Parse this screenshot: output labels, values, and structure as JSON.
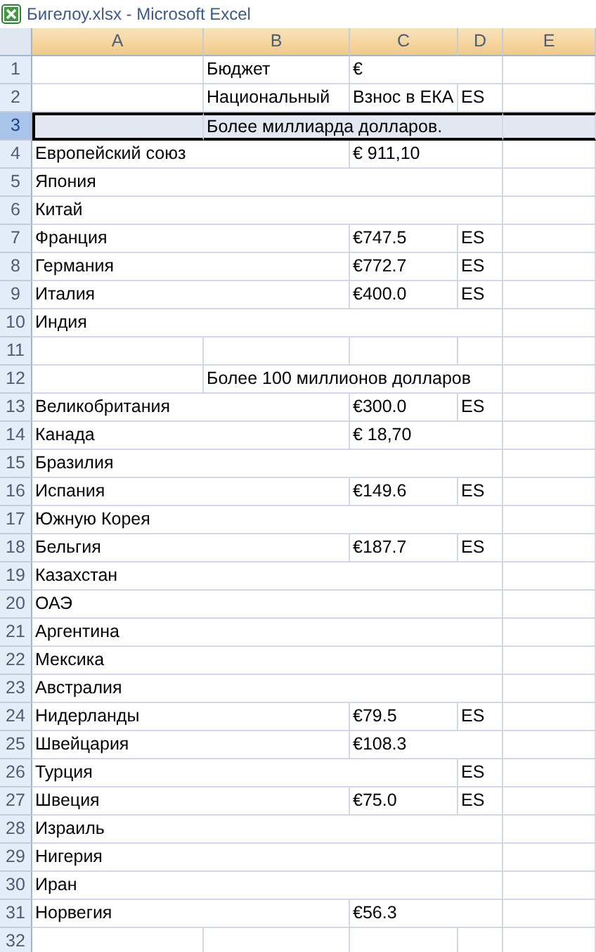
{
  "window": {
    "title": "Бигелоу.xlsx - Microsoft Excel"
  },
  "columns": [
    "A",
    "B",
    "C",
    "D",
    "E"
  ],
  "rows": [
    {
      "number": "1",
      "selected": false,
      "cells": {
        "b": "Бюджет",
        "c": "€"
      }
    },
    {
      "number": "2",
      "selected": false,
      "cells": {
        "b": "Национальный",
        "c": "Взнос в ЕКА",
        "d": "ES"
      }
    },
    {
      "number": "3",
      "selected": true,
      "cells": {
        "b": "Более миллиарда долларов."
      }
    },
    {
      "number": "4",
      "selected": false,
      "cells": {
        "a": "Европейский союз",
        "c": "€ 911,10"
      }
    },
    {
      "number": "5",
      "selected": false,
      "cells": {
        "a": "Япония"
      }
    },
    {
      "number": "6",
      "selected": false,
      "cells": {
        "a": "Китай"
      }
    },
    {
      "number": "7",
      "selected": false,
      "cells": {
        "a": "Франция",
        "c": "€747.5",
        "d": "ES"
      }
    },
    {
      "number": "8",
      "selected": false,
      "cells": {
        "a": "Германия",
        "c": "€772.7",
        "d": "ES"
      }
    },
    {
      "number": "9",
      "selected": false,
      "cells": {
        "a": "Италия",
        "c": "€400.0",
        "d": "ES"
      }
    },
    {
      "number": "10",
      "selected": false,
      "cells": {
        "a": "Индия"
      }
    },
    {
      "number": "11",
      "selected": false,
      "cells": {}
    },
    {
      "number": "12",
      "selected": false,
      "cells": {
        "b": "Более 100 миллионов долларов"
      }
    },
    {
      "number": "13",
      "selected": false,
      "cells": {
        "a": "Великобритания",
        "c": "€300.0",
        "d": "ES"
      }
    },
    {
      "number": "14",
      "selected": false,
      "cells": {
        "a": "Канада",
        "c": "€ 18,70"
      }
    },
    {
      "number": "15",
      "selected": false,
      "cells": {
        "a": "Бразилия"
      }
    },
    {
      "number": "16",
      "selected": false,
      "cells": {
        "a": "Испания",
        "c": "€149.6",
        "d": "ES"
      }
    },
    {
      "number": "17",
      "selected": false,
      "cells": {
        "a": "Южную Корея"
      }
    },
    {
      "number": "18",
      "selected": false,
      "cells": {
        "a": "Бельгия",
        "c": "€187.7",
        "d": "ES"
      }
    },
    {
      "number": "19",
      "selected": false,
      "cells": {
        "a": "Казахстан"
      }
    },
    {
      "number": "20",
      "selected": false,
      "cells": {
        "a": "ОАЭ"
      }
    },
    {
      "number": "21",
      "selected": false,
      "cells": {
        "a": "Аргентина"
      }
    },
    {
      "number": "22",
      "selected": false,
      "cells": {
        "a": "Мексика"
      }
    },
    {
      "number": "23",
      "selected": false,
      "cells": {
        "a": "Австралия"
      }
    },
    {
      "number": "24",
      "selected": false,
      "cells": {
        "a": "Нидерланды",
        "c": "€79.5",
        "d": "ES"
      }
    },
    {
      "number": "25",
      "selected": false,
      "cells": {
        "a": "Швейцария",
        "c": "€108.3"
      }
    },
    {
      "number": "26",
      "selected": false,
      "cells": {
        "a": "Турция",
        "d": "ES"
      }
    },
    {
      "number": "27",
      "selected": false,
      "cells": {
        "a": "Швеция",
        "c": "€75.0",
        "d": "ES"
      }
    },
    {
      "number": "28",
      "selected": false,
      "cells": {
        "a": "Израиль"
      }
    },
    {
      "number": "29",
      "selected": false,
      "cells": {
        "a": "Нигерия"
      }
    },
    {
      "number": "30",
      "selected": false,
      "cells": {
        "a": "Иран"
      }
    },
    {
      "number": "31",
      "selected": false,
      "cells": {
        "a": "Норвегия",
        "c": "€56.3"
      }
    },
    {
      "number": "32",
      "selected": false,
      "cells": {}
    }
  ]
}
